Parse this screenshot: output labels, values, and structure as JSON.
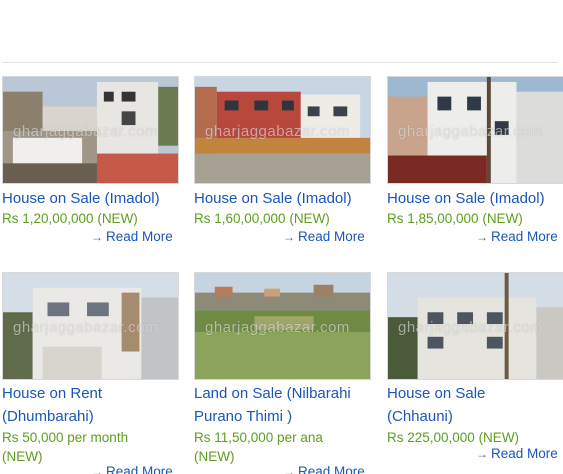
{
  "watermark": "gharjaggabazar.com",
  "listings": [
    {
      "title": "House on Sale (Imadol)",
      "price": "Rs 1,20,00,000 (NEW)",
      "read_more": "Read More"
    },
    {
      "title": "House on Sale (Imadol)",
      "price": "Rs 1,60,00,000 (NEW)",
      "read_more": "Read More"
    },
    {
      "title": "House on Sale (Imadol)",
      "price": "Rs 1,85,00,000 (NEW)",
      "read_more": "Read More"
    },
    {
      "title": "House on Rent (Dhumbarahi)",
      "price": "Rs 50,000 per month (NEW)",
      "read_more": "Read More"
    },
    {
      "title": "Land on Sale (Nilbarahi Purano Thimi )",
      "price": "Rs 11,50,000 per ana (NEW)",
      "read_more": "Read More"
    },
    {
      "title": "House on Sale (Chhauni)",
      "price": "Rs 225,00,000 (NEW)",
      "read_more": "Read More"
    }
  ],
  "icons": {
    "read_more_arrow": "right-arrow-icon"
  }
}
